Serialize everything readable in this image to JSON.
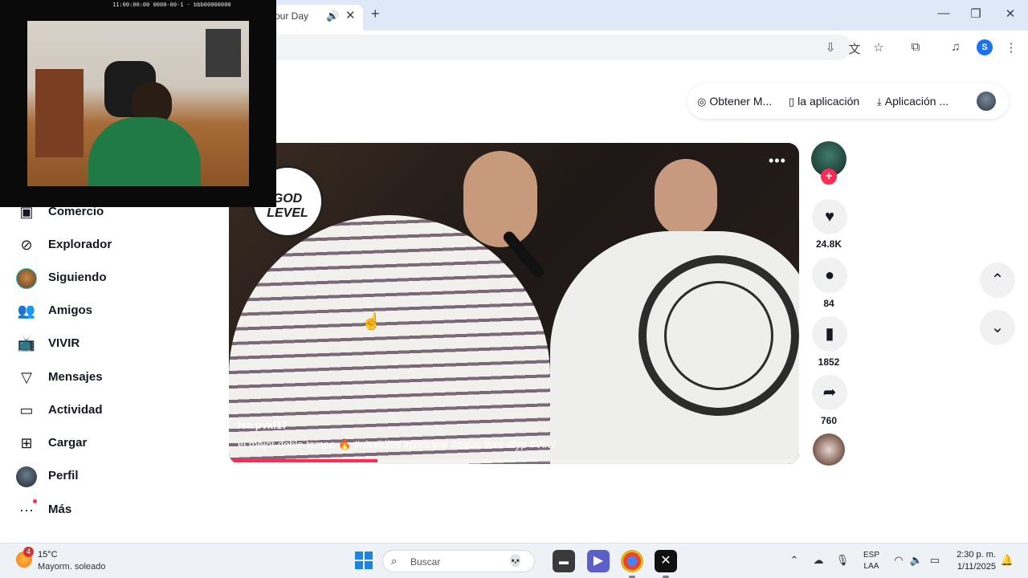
{
  "browser": {
    "tab_title": "our Day",
    "tab_audio_icon": "speaker-icon",
    "tab_close": "✕",
    "new_tab": "+",
    "profile_letter": "S"
  },
  "header": {
    "actions": [
      {
        "label": "Obtener M...",
        "icon": "coin-icon"
      },
      {
        "label": "la aplicación",
        "icon": "phone-icon"
      },
      {
        "label": "Aplicación ...",
        "icon": "download-icon"
      }
    ]
  },
  "sidebar": {
    "items": [
      {
        "label": "Comercio",
        "icon": "shop-icon"
      },
      {
        "label": "Explorador",
        "icon": "compass-icon"
      },
      {
        "label": "Siguiendo",
        "icon": "following-avatar"
      },
      {
        "label": "Amigos",
        "icon": "friends-icon"
      },
      {
        "label": "VIVIR",
        "icon": "live-icon"
      },
      {
        "label": "Mensajes",
        "icon": "send-icon"
      },
      {
        "label": "Actividad",
        "icon": "activity-icon"
      },
      {
        "label": "Cargar",
        "icon": "upload-icon"
      },
      {
        "label": "Perfil",
        "icon": "profile-avatar"
      },
      {
        "label": "Más",
        "icon": "more-icon"
      }
    ]
  },
  "webcam": {
    "overlay_text": "11:00:00:00  0000-00-1  ·  bbb00000000"
  },
  "video": {
    "logo_text": "GOD LEVEL",
    "username": "isa.pvxl17",
    "caption": "el mejor doble tempo 🔥 #niveldios #principal #estilo libre #fyp #Viral",
    "progress": 0.26
  },
  "actions": {
    "likes": "24.8K",
    "comments": "84",
    "saves": "1852",
    "shares": "760"
  },
  "taskbar": {
    "weather_temp": "15°C",
    "weather_desc": "Mayorm. soleado",
    "weather_badge": "4",
    "search_placeholder": "Buscar",
    "lang_top": "ESP",
    "lang_bottom": "LAA",
    "time": "2:30 p. m.",
    "date": "1/11/2025"
  },
  "colors": {
    "accent": "#fe2c55",
    "chrome_tabstrip": "#dfe8f7",
    "taskbar": "#eef1f6"
  }
}
